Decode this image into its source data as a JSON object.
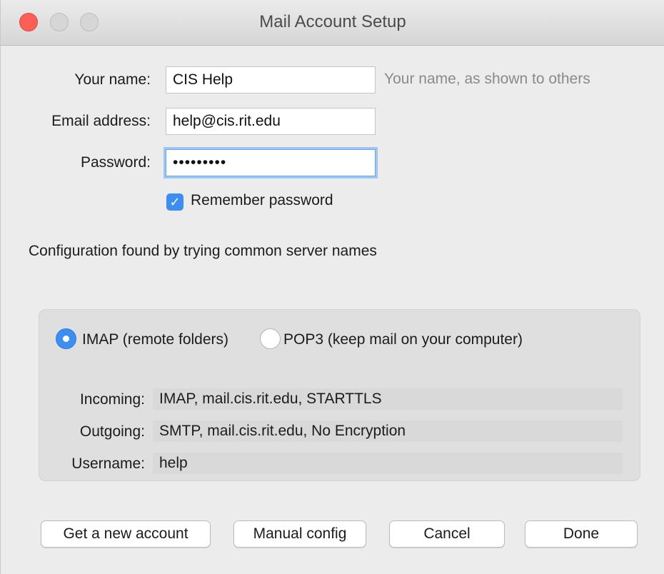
{
  "window": {
    "title": "Mail Account Setup"
  },
  "form": {
    "name_label": "Your name:",
    "name_value": "CIS Help",
    "name_hint": "Your name, as shown to others",
    "email_label": "Email address:",
    "email_value": "help@cis.rit.edu",
    "password_label": "Password:",
    "password_value": "•••••••••",
    "remember_label": "Remember password",
    "remember_checked": true
  },
  "config": {
    "status": "Configuration found by trying common server names",
    "imap_label": "IMAP (remote folders)",
    "pop3_label": "POP3 (keep mail on your computer)",
    "selected": "IMAP",
    "incoming_label": "Incoming:",
    "incoming_value": "IMAP, mail.cis.rit.edu, STARTTLS",
    "outgoing_label": "Outgoing:",
    "outgoing_value": "SMTP, mail.cis.rit.edu, No Encryption",
    "username_label": "Username:",
    "username_value": "help"
  },
  "buttons": {
    "new_account": "Get a new account",
    "manual": "Manual config",
    "cancel": "Cancel",
    "done": "Done"
  },
  "colors": {
    "accent": "#3e8ef1",
    "close": "#fc5f57"
  }
}
